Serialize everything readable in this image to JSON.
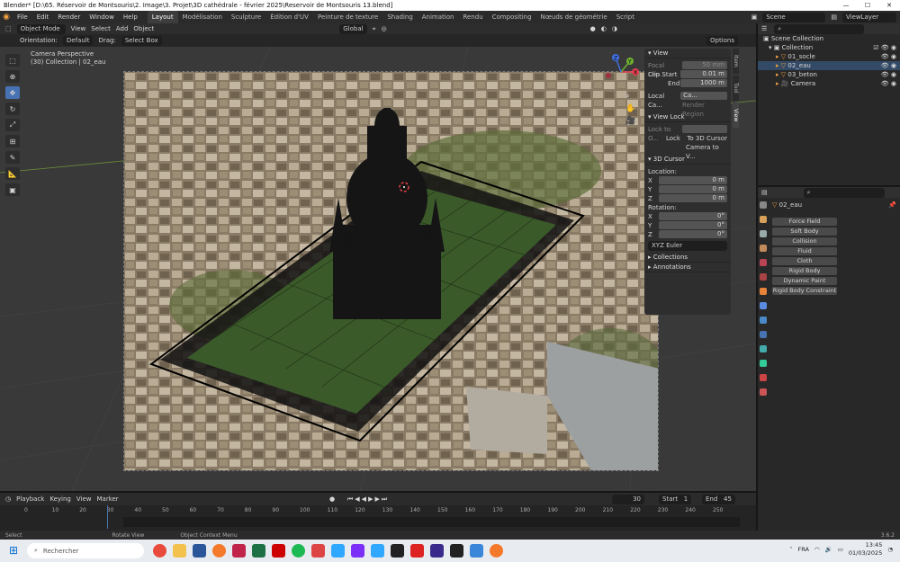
{
  "title_bar": {
    "title": "Blender* [D:\\65. Réservoir de Montsouris\\2. Image\\3. Projet\\3D cathédrale - février 2025\\Reservoir de Montsouris 13.blend]",
    "min": "—",
    "max": "☐",
    "close": "✕"
  },
  "menu": [
    "File",
    "Edit",
    "Render",
    "Window",
    "Help"
  ],
  "workspaces": [
    "Layout",
    "Modélisation",
    "Sculpture",
    "Édition d'UV",
    "Peinture de texture",
    "Shading",
    "Animation",
    "Rendu",
    "Compositing",
    "Nœuds de géométrie",
    "Script"
  ],
  "top_right": {
    "scene": "Scene",
    "view_layer": "ViewLayer"
  },
  "header3d": {
    "mode": "Object Mode",
    "items": [
      "View",
      "Select",
      "Add",
      "Object"
    ],
    "transform": "Global",
    "options": "Options"
  },
  "toolhdr": {
    "orientation_label": "Orientation:",
    "orientation": "Default",
    "drag_label": "Drag:",
    "drag": "Select Box"
  },
  "viewport_info": {
    "line1": "Camera Perspective",
    "line2": "(30) Collection | 02_eau"
  },
  "npanel": {
    "view_title": "View",
    "focal_label": "Focal Len...",
    "focal": "50 mm",
    "clip_start_label": "Clip Start",
    "clip_start": "0.01 m",
    "end_label": "End",
    "end": "1000 m",
    "local_cam_label": "Local Ca...",
    "local_cam": "Ca...",
    "render_region": "Render Region",
    "view_lock_title": "View Lock",
    "lock_to_label": "Lock to O...",
    "lock_label": "Lock",
    "to_3d_cursor": "To 3D Cursor",
    "camera_to_view": "Camera to V...",
    "cursor_title": "3D Cursor",
    "location_label": "Location:",
    "loc_x": "0 m",
    "loc_y": "0 m",
    "loc_z": "0 m",
    "rotation_label": "Rotation:",
    "rot_x": "0°",
    "rot_y": "0°",
    "rot_z": "0°",
    "euler": "XYZ Euler",
    "collections": "Collections",
    "annotations": "Annotations",
    "axes": {
      "x": "X",
      "y": "Y",
      "z": "Z"
    }
  },
  "ntabs": [
    "Item",
    "Tool",
    "View"
  ],
  "outliner": {
    "root": "Scene Collection",
    "collection": "Collection",
    "items": [
      "01_socle",
      "02_eau",
      "03_beton",
      "Camera"
    ]
  },
  "properties": {
    "object_name": "02_eau",
    "physics": [
      "Force Field",
      "Soft Body",
      "Collision",
      "Fluid",
      "Cloth",
      "Rigid Body",
      "Dynamic Paint",
      "Rigid Body Constraint"
    ]
  },
  "timeline": {
    "menus": [
      "Playback",
      "Keying",
      "View",
      "Marker"
    ],
    "current_frame": "30",
    "start_label": "Start",
    "start": "1",
    "end_label": "End",
    "end": "45",
    "ticks": [
      "0",
      "10",
      "20",
      "30",
      "40",
      "50",
      "60",
      "70",
      "80",
      "90",
      "100",
      "110",
      "120",
      "130",
      "140",
      "150",
      "160",
      "170",
      "180",
      "190",
      "200",
      "210",
      "220",
      "230",
      "240",
      "250"
    ]
  },
  "statusbar": {
    "select": "Select",
    "rotate": "Rotate View",
    "context": "Object Context Menu",
    "version": "3.6.2"
  },
  "taskbar": {
    "search_placeholder": "Rechercher",
    "lang": "FRA",
    "time": "13:45",
    "date": "01/03/2025"
  },
  "colors": {
    "accent": "#4772b3",
    "active_orange": "#f0a040",
    "grid": "#3c3c3c"
  }
}
